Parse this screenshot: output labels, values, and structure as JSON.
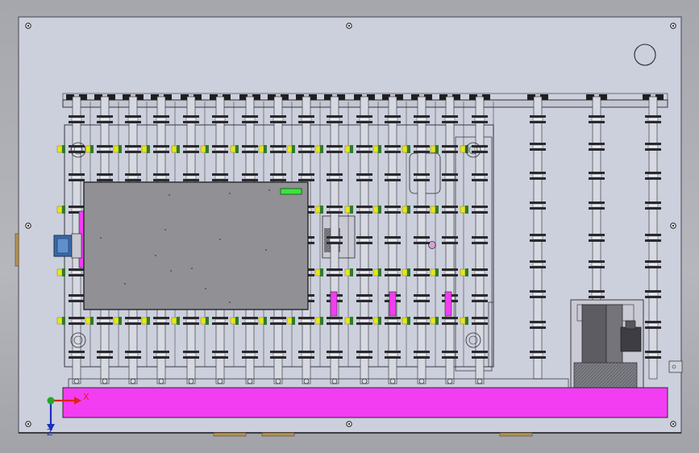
{
  "drawing": {
    "colors": {
      "background": "#b0b0b7",
      "sheet": "#cccfdc",
      "sheet_edge": "#5a5a64",
      "line": "#2a2a2e",
      "frame": "#c4c6d2",
      "screen": "#909095",
      "magenta": "#f23df2",
      "indicator": "#36e836",
      "bolt_yellow": "#e6e61a",
      "bolt_green": "#2f7a2f",
      "connector_blue": "#3a6aa8"
    },
    "components": {
      "display_panel": "display-panel",
      "magenta_rail": "magenta-rail",
      "roller_array": "roller-array",
      "motor_assembly": "motor-assembly",
      "side_connector": "side-connector",
      "corner_circle": "corner-circle"
    }
  },
  "triad": {
    "x_label": "X",
    "y_label": "",
    "z_label": "Z",
    "x_color": "#e02020",
    "y_color": "#1a8a1a",
    "z_color": "#1a2fbf"
  }
}
